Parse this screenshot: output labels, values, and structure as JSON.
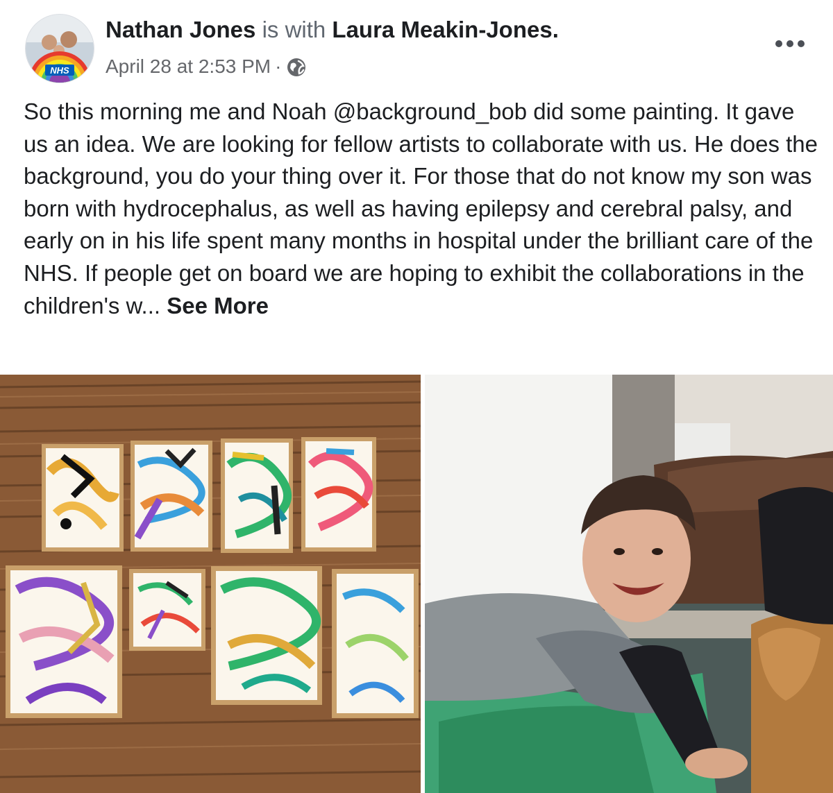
{
  "post": {
    "author": "Nathan Jones",
    "with_text": "is with",
    "tagged_user": "Laura Meakin-Jones.",
    "timestamp": "April 28 at 2:53 PM",
    "separator": "·",
    "privacy_icon": "globe-icon",
    "more_icon": "more-horizontal-icon",
    "avatar_badge": "NHS",
    "text": "So this morning me and Noah @background_bob did some painting. It gave us an idea. We are looking for fellow artists to collaborate with us. He does the background, you do your thing over it. For those that do not know my son was born with hydrocephalus, as well as having epilepsy and cerebral palsy, and early on in his life spent many months in hospital under the brilliant care of the NHS. If people get on board we are hoping to exhibit the collaborations in the children's w...",
    "see_more": "See More"
  },
  "colors": {
    "text": "#1c1e21",
    "secondary": "#65676b",
    "background": "#ffffff"
  }
}
